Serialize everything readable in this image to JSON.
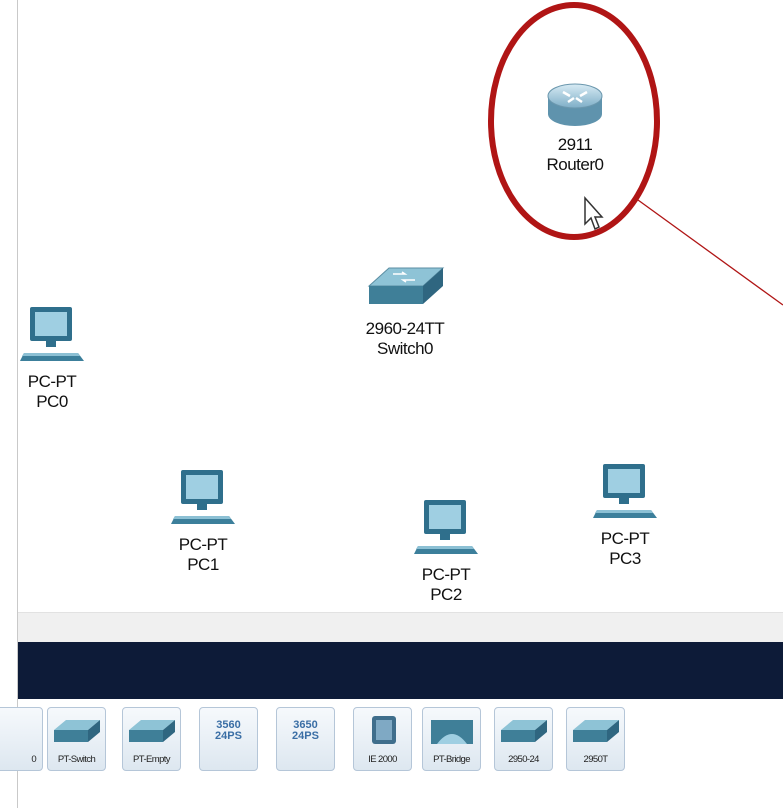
{
  "devices": {
    "router": {
      "model": "2911",
      "name": "Router0"
    },
    "switch": {
      "model": "2960-24TT",
      "name": "Switch0"
    },
    "pc0": {
      "model": "PC-PT",
      "name": "PC0"
    },
    "pc1": {
      "model": "PC-PT",
      "name": "PC1"
    },
    "pc2": {
      "model": "PC-PT",
      "name": "PC2"
    },
    "pc3": {
      "model": "PC-PT",
      "name": "PC3"
    }
  },
  "palette": {
    "items": [
      {
        "label": "0"
      },
      {
        "label": "PT-Switch"
      },
      {
        "label": "PT-Empty"
      },
      {
        "label": "3560\n24PS"
      },
      {
        "label": "3650\n24PS"
      },
      {
        "label": "IE 2000"
      },
      {
        "label": "PT-Bridge"
      },
      {
        "label": "2950-24"
      },
      {
        "label": "2950T"
      }
    ]
  },
  "colors": {
    "highlight_circle": "#b01515",
    "connector_line": "#b01515",
    "navy_bar": "#0d1b38",
    "frame_border": "#3b7bd4"
  }
}
